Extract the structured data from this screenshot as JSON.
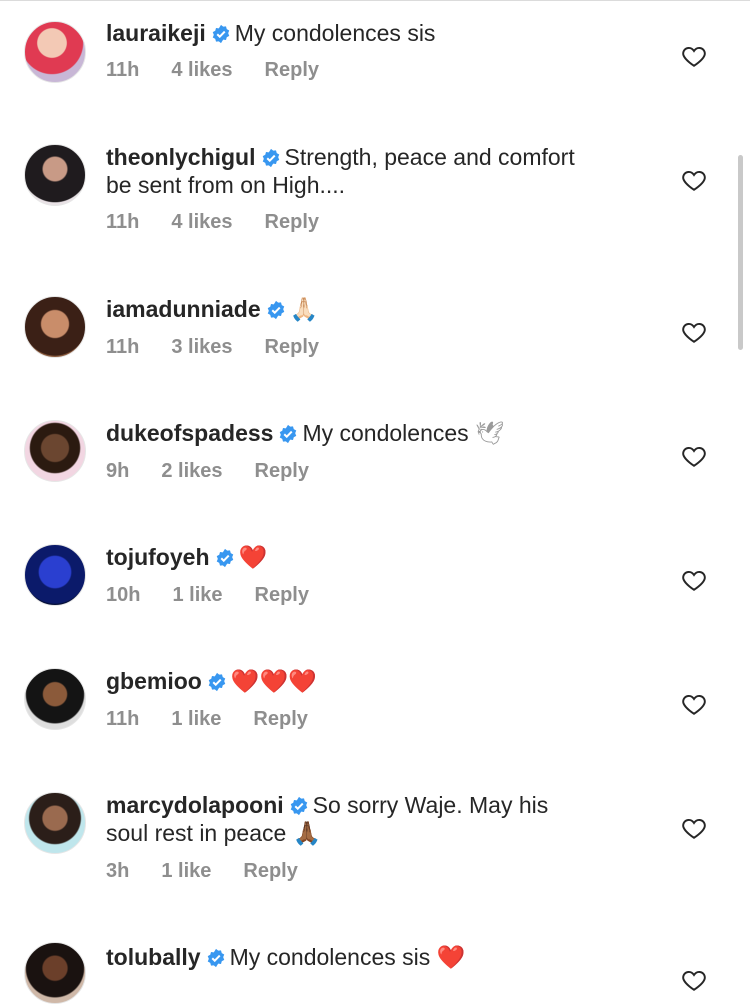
{
  "comments": [
    {
      "username": "lauraikeji",
      "text": "My condolences sis",
      "emoji": "",
      "time": "11h",
      "likes": "4 likes",
      "reply": "Reply"
    },
    {
      "username": "theonlychigul",
      "text": "Strength, peace and comfort",
      "text2": "be sent from on High....",
      "emoji": "",
      "time": "11h",
      "likes": "4 likes",
      "reply": "Reply"
    },
    {
      "username": "iamadunniade",
      "text": "",
      "emoji": "🙏🏻",
      "time": "11h",
      "likes": "3 likes",
      "reply": "Reply"
    },
    {
      "username": "dukeofspadess",
      "text": "My condolences",
      "emoji": "🕊",
      "time": "9h",
      "likes": "2 likes",
      "reply": "Reply"
    },
    {
      "username": "tojufoyeh",
      "text": "",
      "emoji": "❤️",
      "time": "10h",
      "likes": "1 like",
      "reply": "Reply"
    },
    {
      "username": "gbemioo",
      "text": "",
      "emoji": "❤️❤️❤️",
      "time": "11h",
      "likes": "1 like",
      "reply": "Reply"
    },
    {
      "username": "marcydolapooni",
      "text": "So sorry Waje. May his",
      "text2": "soul rest in peace",
      "emoji": "🙏🏾",
      "time": "3h",
      "likes": "1 like",
      "reply": "Reply"
    },
    {
      "username": "tolubally",
      "text": "My condolences sis",
      "emoji": "❤️",
      "time": "",
      "likes": "",
      "reply": ""
    }
  ],
  "colors": {
    "verified": "#3897f0",
    "meta": "#8e8e8e",
    "text": "#262626"
  }
}
